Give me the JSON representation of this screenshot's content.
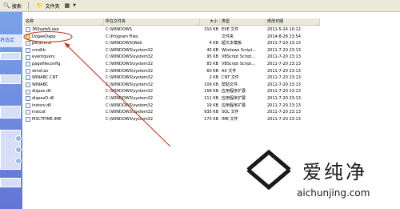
{
  "toolbar": {
    "search_label": "搜索",
    "folders_label": "文件夹"
  },
  "left_pane": {
    "label": "将选定"
  },
  "columns": {
    "name": "名称",
    "location": "所在文件夹",
    "size": "大小",
    "type": "类型",
    "modified": "修改日期"
  },
  "files": [
    {
      "name": "360safe9.exe",
      "location": "C:\\WINDOWS",
      "size": "310 KB",
      "type": "EXE 文件",
      "date": "2011-5-24 10:12",
      "folder": false
    },
    {
      "name": "DogeeDapp",
      "location": "C:\\Program Files",
      "size": "",
      "type": "文件夹",
      "date": "2014-8-28 23:54",
      "folder": true
    },
    {
      "name": "paramind",
      "location": "C:\\WINDOWS\\Web",
      "size": "4 KB",
      "type": "超文本模板",
      "date": "2011-7-20 23:13",
      "folder": false
    },
    {
      "name": "cmdlib",
      "location": "C:\\WINDOWS\\system32",
      "size": "40 KB",
      "type": "Windows Script...",
      "date": "2011-7-20 23:13",
      "folder": false
    },
    {
      "name": "eventquery",
      "location": "C:\\WINDOWS\\system32",
      "size": "95 KB",
      "type": "VBScript Script...",
      "date": "2011-7-20 23:13",
      "folder": false
    },
    {
      "name": "pagefileconfig",
      "location": "C:\\WINDOWS\\system32",
      "size": "83 KB",
      "type": "VBScript Script...",
      "date": "2011-7-20 23:13",
      "folder": false
    },
    {
      "name": "winsf.ax",
      "location": "C:\\WINDOWS\\system32",
      "size": "60 KB",
      "type": "AX 文件",
      "date": "2011-7-20 23:13",
      "folder": false
    },
    {
      "name": "WINABC.CNT",
      "location": "C:\\WINDOWS\\system32",
      "size": "2 KB",
      "type": "CNT 文件",
      "date": "2011-7-20 23:13",
      "folder": false
    },
    {
      "name": "WINABC",
      "location": "C:\\WINDOWS\\system32",
      "size": "109 KB",
      "type": "帮助文件",
      "date": "2011-7-20 23:13",
      "folder": false
    },
    {
      "name": "dispex.dll",
      "location": "C:\\WINDOWS\\system32",
      "size": "158 KB",
      "type": "应用程序扩展",
      "date": "2011-7-20 23:13",
      "folder": false
    },
    {
      "name": "dispexD.dll",
      "location": "C:\\WINDOWS\\system32",
      "size": "111 KB",
      "type": "应用程序扩展",
      "date": "2011-7-20 23:13",
      "folder": false
    },
    {
      "name": "instsrv.dll",
      "location": "C:\\WINDOWS\\system32",
      "size": "19 KB",
      "type": "应用程序扩展",
      "date": "2011-7-20 23:13",
      "folder": false
    },
    {
      "name": "instcat",
      "location": "C:\\WINDOWS\\system32",
      "size": "935 KB",
      "type": "SQL 文件",
      "date": "2011-7-20 23:13",
      "folder": false
    },
    {
      "name": "MSCTFIME.IME",
      "location": "C:\\WINDOWS\\system32",
      "size": "173 KB",
      "type": "IME 文件",
      "date": "2011-7-20 23:13",
      "folder": false
    }
  ],
  "watermark": {
    "brand_cn": "爱纯净",
    "url": "aichunjing.com"
  },
  "colors": {
    "toolbar_bg": "#ece9d8",
    "pane_blue": "#6b8ee0",
    "highlight_red": "#c0392b"
  }
}
